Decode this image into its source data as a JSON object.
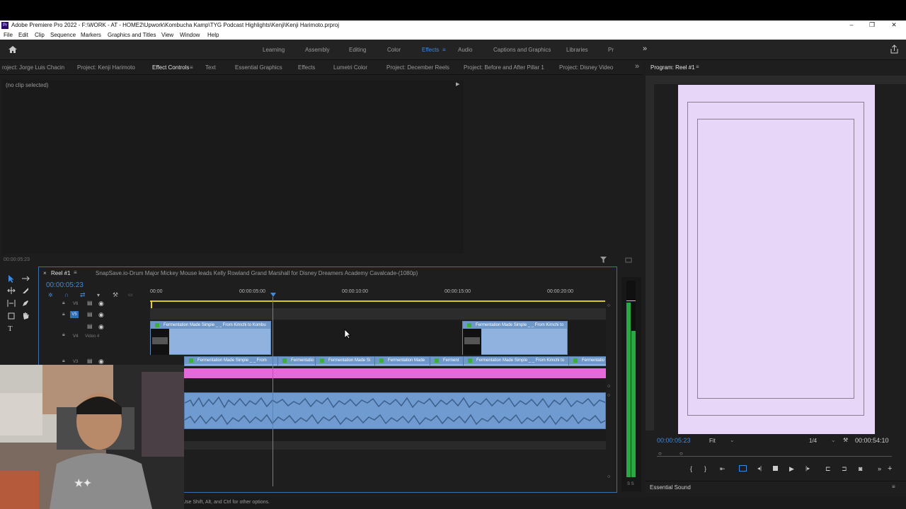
{
  "window": {
    "logo": "Pr",
    "title": "Adobe Premiere Pro 2022 - F:\\WORK - AT - HOME2\\Upwork\\Kombucha Kamp\\TYG Podcast Highlights\\Kenji\\Kenji Harimoto.prproj"
  },
  "menu": [
    "File",
    "Edit",
    "Clip",
    "Sequence",
    "Markers",
    "Graphics and Titles",
    "View",
    "Window",
    "Help"
  ],
  "workspaces": {
    "items": [
      "Learning",
      "Assembly",
      "Editing",
      "Color",
      "Effects",
      "Audio",
      "Captions and Graphics",
      "Libraries",
      "Pr"
    ],
    "active": "Effects",
    "more": "»"
  },
  "panel_tabs": [
    "roject: Jorge Luis Chacin",
    "Project: Kenji Harimoto",
    "Effect Controls",
    "Text",
    "Essential Graphics",
    "Effects",
    "Lumetri Color",
    "Project: December Reels",
    "Project: Before and After Pillar 1",
    "Project: Disney Video"
  ],
  "panel_tabs_more": "»",
  "effect_controls": {
    "no_clip": "(no clip selected)",
    "timecode": "00:00:05:23"
  },
  "program": {
    "title": "Program: Reel #1",
    "timecode": "00:00:05:23",
    "fit": "Fit",
    "resolution": "1/4",
    "duration": "00:00:54:10",
    "canvas_color": "#e8d6f8"
  },
  "timeline": {
    "tab": "Reel #1",
    "sequence2": "SnapSave.io-Drum Major Mickey Mouse leads Kelly Rowland Grand Marshall for Disney Dreamers Academy Cavalcade-(1080p)",
    "timecode": "00:00:05:23",
    "ruler": [
      "00:00",
      "00:00:05:00",
      "00:00:10:00",
      "00:00:15:00",
      "00:00:20:00"
    ],
    "tracks": [
      "V6",
      "V5",
      "V4",
      "V3"
    ],
    "track_name_v4": "Video 4",
    "clips_v4": [
      "Fermentation Made Simple _ _ From Kimchi to Kombu",
      "Fermentation Made Simple _ _ From Kimchi to"
    ],
    "clips_v3": [
      "Fermentation Made Simple _ _ From",
      "Fermentatio",
      "Fermentation Made Si",
      "Fermentation Made",
      "Ferment",
      "Fermentation Made Simple _ _ From Kimchi to",
      "Fermentatio"
    ],
    "meter_scale": "S S"
  },
  "transport_icons": [
    "mark-in",
    "mark-out",
    "go-to-in",
    "lift",
    "step-back",
    "stop",
    "play",
    "step-forward",
    "go-to-out",
    "insert",
    "overwrite",
    "export-frame"
  ],
  "essential_sound": "Essential Sound",
  "status_hint": "Use Shift, Alt, and Ctrl for other options.",
  "colors": {
    "accent": "#3d8ae0",
    "pink_track": "#e36ad8",
    "video_clip": "#8fb3de",
    "audio_clip": "#6f9bd1",
    "playhead": "#3d8ae0"
  }
}
